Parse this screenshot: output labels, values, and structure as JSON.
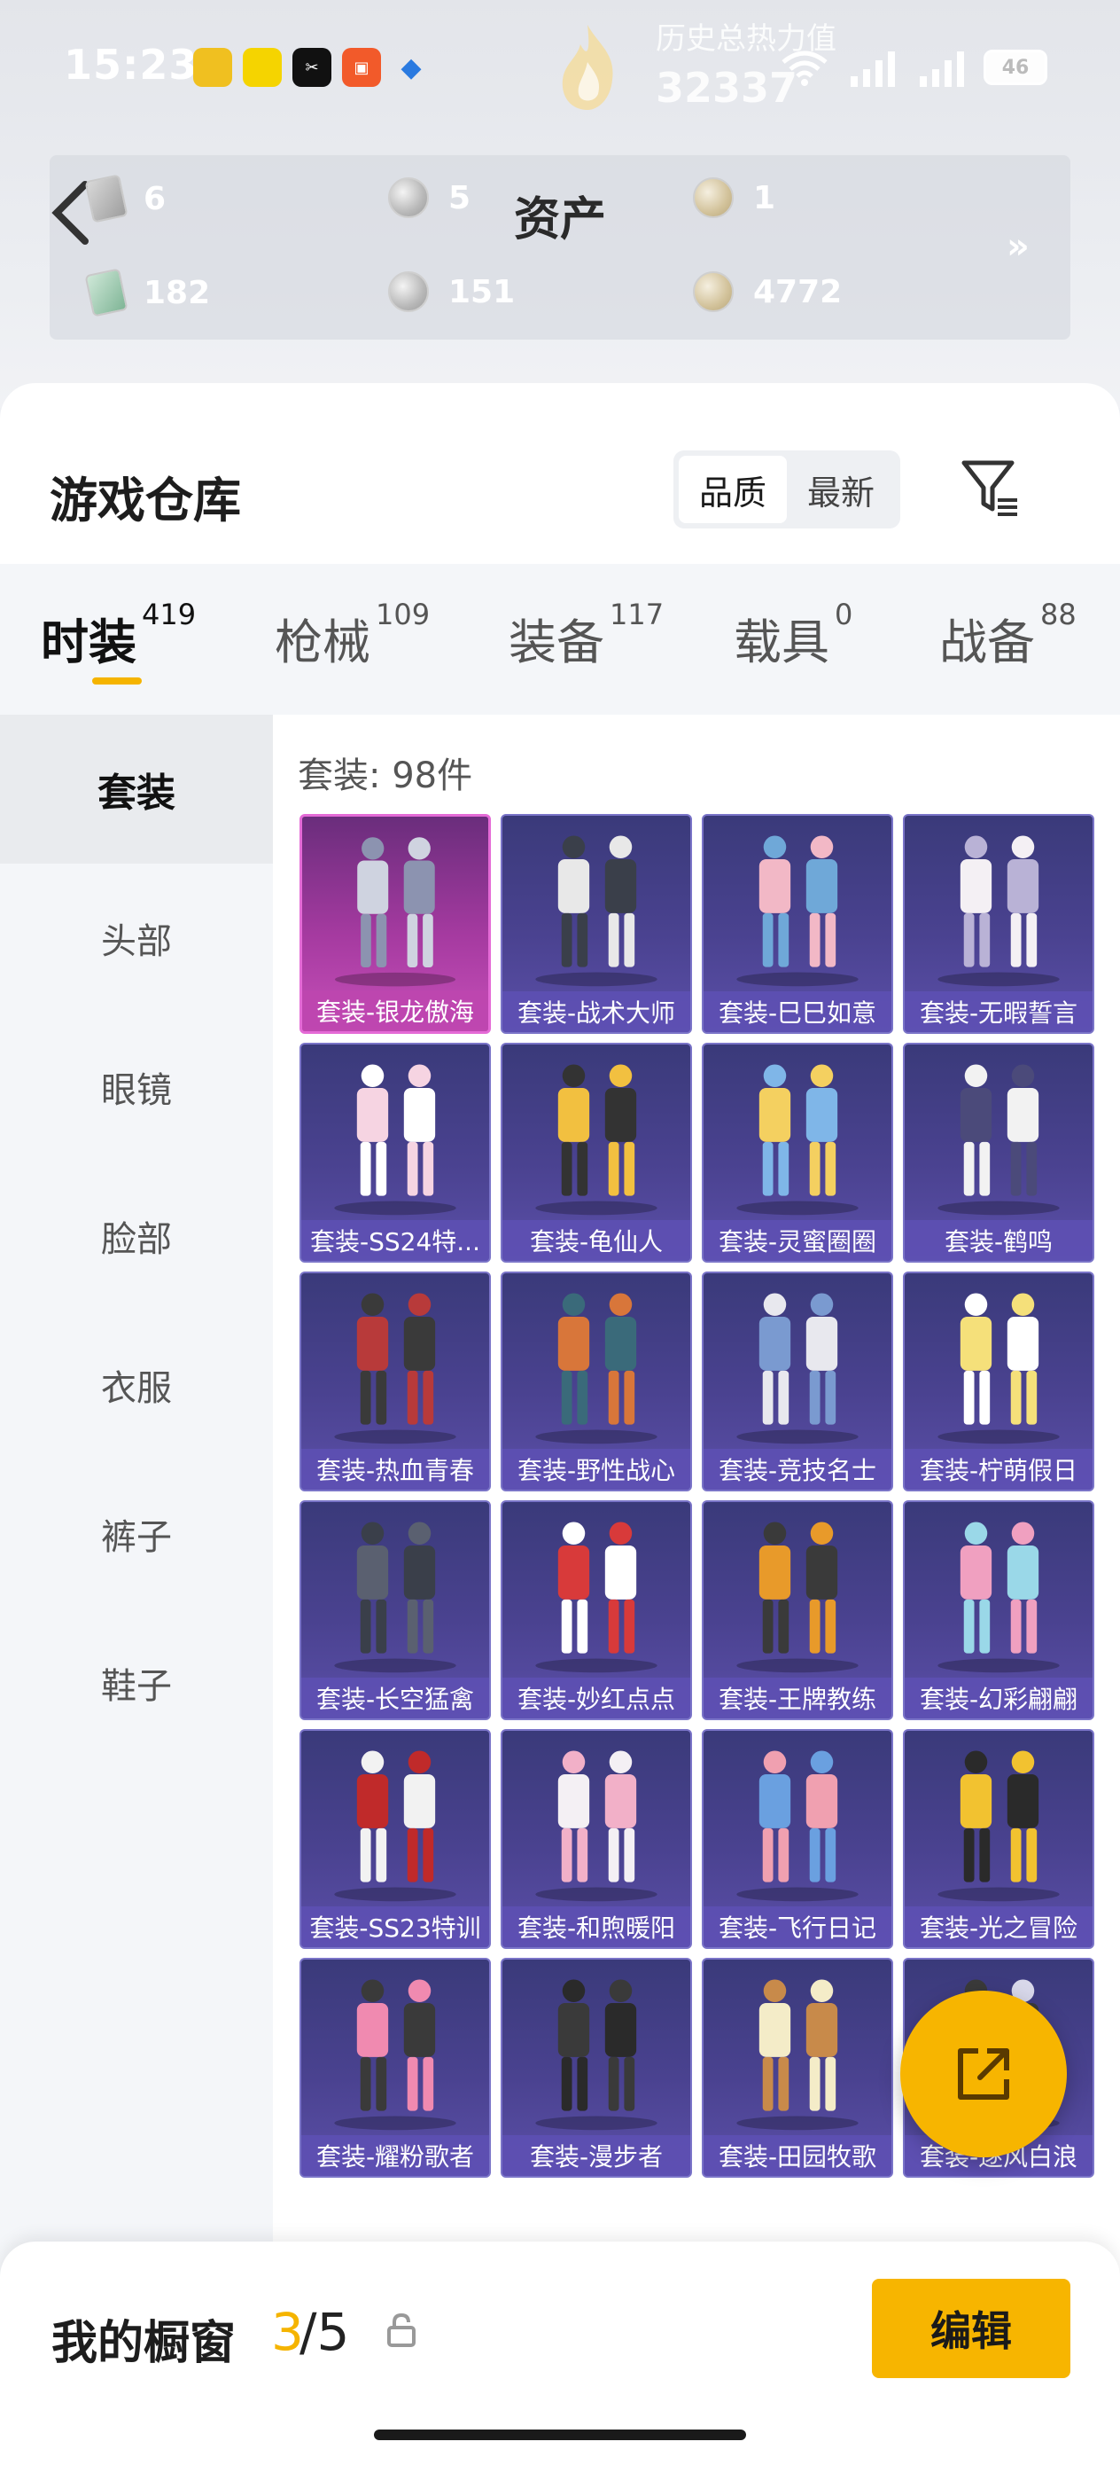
{
  "status_bar": {
    "time": "15:23",
    "battery": "46"
  },
  "heat": {
    "label": "历史总热力值",
    "value": "32337"
  },
  "assets": {
    "title": "资产",
    "items": [
      {
        "icon": "gray-card-icon",
        "value": "6"
      },
      {
        "icon": "silver-coin-icon",
        "value": "5"
      },
      {
        "icon": "gold-coin-icon",
        "value": "1"
      },
      {
        "icon": "green-card-icon",
        "value": "182"
      },
      {
        "icon": "silver-coin-icon",
        "value": "151"
      },
      {
        "icon": "gold-coin-icon",
        "value": "4772"
      }
    ],
    "more": "»"
  },
  "warehouse": {
    "title": "游戏仓库",
    "sort_options": [
      "品质",
      "最新"
    ],
    "active_sort": "品质"
  },
  "categories": [
    {
      "label": "时装",
      "count": "419",
      "active": true
    },
    {
      "label": "枪械",
      "count": "109",
      "active": false
    },
    {
      "label": "装备",
      "count": "117",
      "active": false
    },
    {
      "label": "载具",
      "count": "0",
      "active": false
    },
    {
      "label": "战备",
      "count": "88",
      "active": false
    }
  ],
  "sidebar": {
    "items": [
      "套装",
      "头部",
      "眼镜",
      "脸部",
      "衣服",
      "裤子",
      "鞋子"
    ],
    "active": "套装"
  },
  "grid": {
    "count_label": "套装: 98件",
    "items": [
      "套装-银龙傲海",
      "套装-战术大师",
      "套装-巳巳如意",
      "套装-无暇誓言",
      "套装-SS24特...",
      "套装-龟仙人",
      "套装-灵蜜圈圈",
      "套装-鹤鸣",
      "套装-热血青春",
      "套装-野性战心",
      "套装-竞技名士",
      "套装-柠萌假日",
      "套装-长空猛禽",
      "套装-妙红点点",
      "套装-王牌教练",
      "套装-幻彩翩翩",
      "套装-SS23特训",
      "套装-和煦暖阳",
      "套装-飞行日记",
      "套装-光之冒险",
      "套装-耀粉歌者",
      "套装-漫步者",
      "套装-田园牧歌",
      "套装-逐风白浪"
    ]
  },
  "showcase": {
    "label": "我的橱窗",
    "current": "3",
    "total": "/5",
    "edit_label": "编辑"
  },
  "colors": {
    "accent": "#f7b500",
    "tile_purple": "#4a4290",
    "tile_pink": "#a53aa0"
  }
}
